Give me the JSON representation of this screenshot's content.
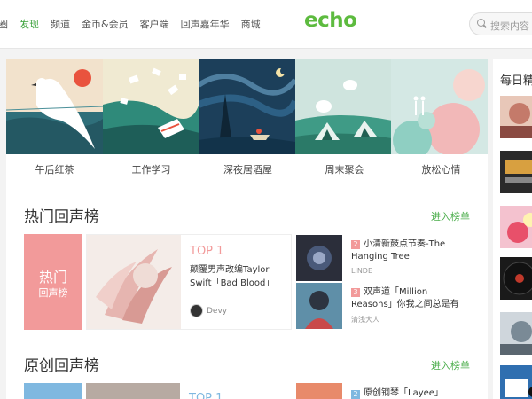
{
  "nav": {
    "items": [
      "圈",
      "发现",
      "频道",
      "金币&会员",
      "客户端",
      "回声嘉年华",
      "商城"
    ],
    "active_index": 1
  },
  "logo": "echo",
  "search": {
    "placeholder": "搜索内容"
  },
  "banner": {
    "captions": [
      "午后红茶",
      "工作学习",
      "深夜居酒屋",
      "周末聚会",
      "放松心情"
    ]
  },
  "hot_chart": {
    "title": "热门回声榜",
    "more": "进入榜单",
    "box_line1": "热门",
    "box_line2": "回声榜",
    "top1": {
      "rank": "TOP 1",
      "title": "颠覆男声改编Taylor Swift「Bad Blood」",
      "user": "Devy"
    },
    "items": [
      {
        "rank": "2",
        "title": "小清新鼓点节奏-The Hanging Tree",
        "artist": "LINDE"
      },
      {
        "rank": "3",
        "title": "双声道「Million Reasons」你我之间总是有",
        "artist": "清浅大人"
      }
    ]
  },
  "original_chart": {
    "title": "原创回声榜",
    "more": "进入榜单",
    "top1_rank": "TOP 1",
    "items": [
      {
        "rank": "2",
        "title": "原创钢琴「Layee」"
      }
    ]
  },
  "right": {
    "title": "每日精"
  },
  "colors": {
    "accent_green": "#4cae4c",
    "hot_pink": "#f29a9a"
  }
}
